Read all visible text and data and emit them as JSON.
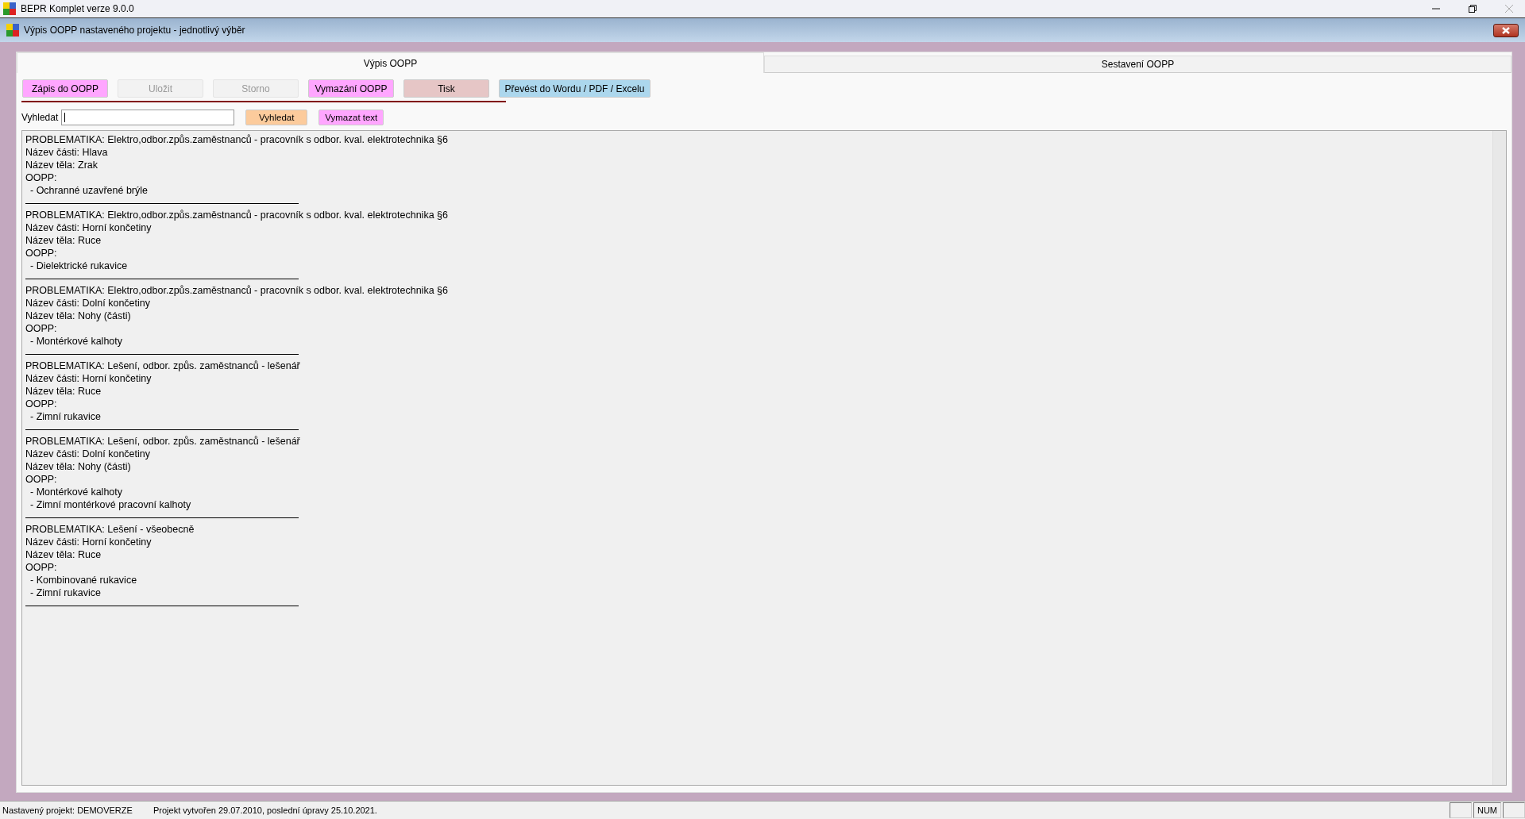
{
  "app_window": {
    "title": "BEPR Komplet verze 9.0.0"
  },
  "dialog": {
    "title": "Výpis OOPP nastaveného projektu - jednotlivý výběr"
  },
  "tabs": [
    {
      "label": "Výpis OOPP",
      "selected": true
    },
    {
      "label": "Sestavení OOPP",
      "selected": false
    }
  ],
  "toolbar_buttons": [
    {
      "label": "Zápis do OOPP",
      "color": "#ffa6ff",
      "disabled": false
    },
    {
      "label": "Uložit",
      "color": "#f2f2f2",
      "disabled": true
    },
    {
      "label": "Storno",
      "color": "#f2f2f2",
      "disabled": true
    },
    {
      "label": "Vymazání OOPP",
      "color": "#ffa6ff",
      "disabled": false
    },
    {
      "label": "Tisk",
      "color": "#e6c6c6",
      "disabled": false
    },
    {
      "label": "Převést do Wordu / PDF / Excelu",
      "color": "#acd7ed",
      "disabled": false
    }
  ],
  "search": {
    "label": "Vyhledat",
    "buttons": [
      {
        "label": "Vyhledat",
        "color": "#fccb9c"
      },
      {
        "label": "Vymazat text",
        "color": "#ffa6ff"
      }
    ]
  },
  "records": [
    {
      "lines": [
        "PROBLEMATIKA: Elektro,odbor.způs.zaměstnanců - pracovník s odbor. kval. elektrotechnika §6",
        "Název části: Hlava",
        "Název těla: Zrak",
        "OOPP:"
      ],
      "items": [
        "- Ochranné uzavřené brýle"
      ]
    },
    {
      "lines": [
        "PROBLEMATIKA: Elektro,odbor.způs.zaměstnanců - pracovník s odbor. kval. elektrotechnika §6",
        "Název části: Horní končetiny",
        "Název těla: Ruce",
        "OOPP:"
      ],
      "items": [
        "- Dielektrické rukavice"
      ]
    },
    {
      "lines": [
        "PROBLEMATIKA: Elektro,odbor.způs.zaměstnanců - pracovník s odbor. kval. elektrotechnika §6",
        "Název části: Dolní končetiny",
        "Název těla: Nohy (části)",
        "OOPP:"
      ],
      "items": [
        "- Montérkové kalhoty"
      ]
    },
    {
      "lines": [
        "PROBLEMATIKA: Lešení, odbor. způs. zaměstnanců - lešenář",
        "Název části: Horní končetiny",
        "Název těla: Ruce",
        "OOPP:"
      ],
      "items": [
        "- Zimní rukavice"
      ]
    },
    {
      "lines": [
        "PROBLEMATIKA: Lešení, odbor. způs. zaměstnanců - lešenář",
        "Název části: Dolní končetiny",
        "Název těla: Nohy (části)",
        "OOPP:"
      ],
      "items": [
        "- Montérkové kalhoty",
        "- Zimní montérkové pracovní kalhoty"
      ]
    },
    {
      "lines": [
        "PROBLEMATIKA: Lešení - všeobecně",
        "Název části: Horní končetiny",
        "Název těla: Ruce",
        "OOPP:"
      ],
      "items": [
        "- Kombinované rukavice",
        "- Zimní rukavice"
      ]
    }
  ],
  "status_bar": {
    "project": "Nastavený projekt: DEMOVERZE",
    "info": "Projekt vytvořen 29.07.2010, poslední úpravy 25.10.2021.",
    "indicator": "NUM"
  }
}
